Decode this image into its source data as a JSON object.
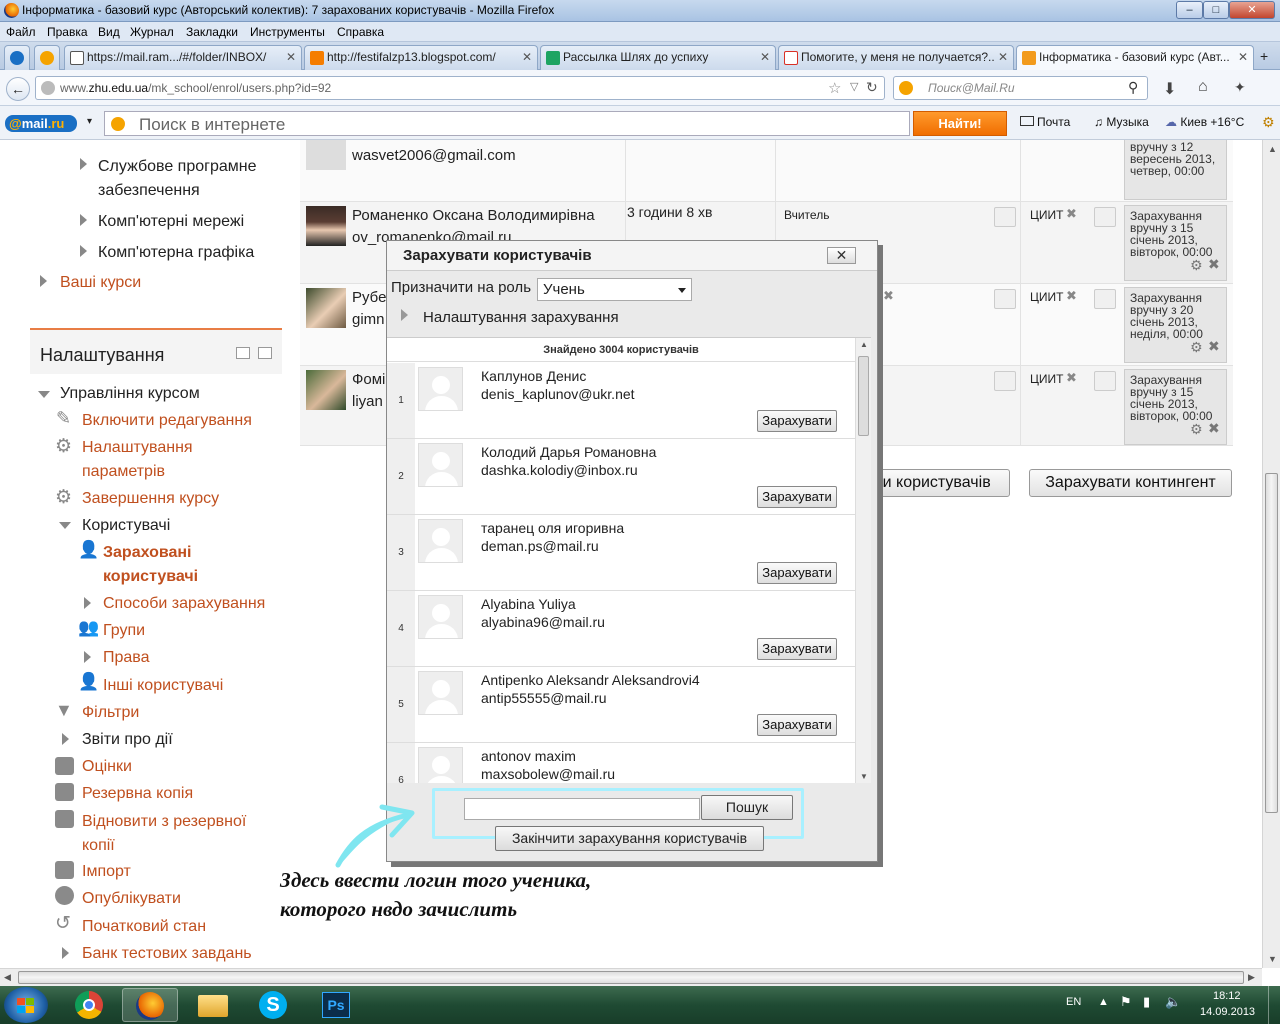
{
  "window": {
    "title": "Інформатика - базовий курс (Авторський колектив): 7 зарахованих користувачів - Mozilla Firefox",
    "buttons": {
      "minimize": "–",
      "maximize": "□",
      "close": "✕"
    }
  },
  "menu": [
    "Файл",
    "Правка",
    "Вид",
    "Журнал",
    "Закладки",
    "Инструменты",
    "Справка"
  ],
  "tabs": [
    {
      "label": "https://mail.ram.../#/folder/INBOX/",
      "icon_color": "#555555"
    },
    {
      "label": "http://festifalzp13.blogspot.com/",
      "icon_color": "#f57d00"
    },
    {
      "label": "Рассылка Шлях до успиху",
      "icon_color": "#1da462"
    },
    {
      "label": "Помогите, у меня не получается?...",
      "icon_color": "#d93025"
    },
    {
      "label": "Інформатика - базовий курс (Авт...",
      "icon_color": "#f29b1d"
    }
  ],
  "nav": {
    "url_prefix": "www.",
    "url_domain": "zhu.edu.ua",
    "url_path": "/mk_school/enrol/users.php?id=92",
    "search_placeholder": "Поиск@Mail.Ru"
  },
  "mailbar": {
    "logo_at": "@",
    "logo_text": "mail",
    "logo_tld": ".ru",
    "search_placeholder": "Поиск в интернете",
    "find_button": "Найти!",
    "mail": "Почта",
    "music": "Музыка",
    "weather": "Киев +16°C"
  },
  "sidebar": {
    "top_items": [
      {
        "label": "Службове програмне"
      },
      {
        "label": "забезпечення"
      },
      {
        "label": "Комп'ютерні мережі"
      },
      {
        "label": "Комп'ютерна графіка"
      }
    ],
    "your_courses": "Ваші курси",
    "settings_title": "Налаштування",
    "course_admin": "Управління курсом",
    "items": [
      {
        "label": "Включити редагування",
        "icon": "pencil-icon"
      },
      {
        "label": "Налаштування параметрів",
        "icon": "gear-icon"
      },
      {
        "label": "Завершення курсу",
        "icon": "gear-icon"
      },
      {
        "label": "Користувачі"
      },
      {
        "label": "Зараховані користувачі",
        "icon": "user-add-icon"
      },
      {
        "label": "Способи зарахування"
      },
      {
        "label": "Групи",
        "icon": "users-icon"
      },
      {
        "label": "Права"
      },
      {
        "label": "Інші користувачі",
        "icon": "user-add-icon"
      },
      {
        "label": "Фільтри",
        "icon": "filter-icon"
      },
      {
        "label": "Звіти про дії"
      },
      {
        "label": "Оцінки",
        "icon": "grades-icon"
      },
      {
        "label": "Резервна копія",
        "icon": "backup-icon"
      },
      {
        "label": "Відновити з резервної копії",
        "icon": "restore-icon"
      },
      {
        "label": "Імпорт",
        "icon": "import-icon"
      },
      {
        "label": "Опублікувати",
        "icon": "publish-icon"
      },
      {
        "label": "Початковий стан",
        "icon": "reset-icon"
      },
      {
        "label": "Банк тестових завдань"
      }
    ]
  },
  "table": {
    "rows": [
      {
        "name": "",
        "email": "wasvet2006@gmail.com",
        "last_access": "",
        "role": "",
        "group": "",
        "status_lines": [
          "вручну з 12",
          "вересень 2013,",
          "четвер, 00:00"
        ]
      },
      {
        "name": "Романенко Оксана Володимирівна",
        "email": "ov_romanenko@mail.ru",
        "last_access": "3 години 8 хв",
        "role": "Вчитель",
        "group": "ЦИИТ",
        "status_lines": [
          "Зарахування",
          "вручну з 15",
          "січень 2013,",
          "вівторок, 00:00"
        ]
      },
      {
        "name": "Рубе",
        "email": "gimn",
        "last_access": "",
        "role": "",
        "group": "ЦИИТ",
        "status_lines": [
          "Зарахування",
          "вручну з 20",
          "січень 2013,",
          "неділя, 00:00"
        ]
      },
      {
        "name": "Фомі",
        "email": "liyan",
        "last_access": "",
        "role": "",
        "group": "ЦИИТ",
        "status_lines": [
          "Зарахування",
          "вручну з 15",
          "січень 2013,",
          "вівторок, 00:00"
        ]
      }
    ],
    "enrol_users_button": "ти користувачів",
    "enrol_cohort_button": "Зарахувати контингент"
  },
  "modal": {
    "title": "Зарахувати користувачів",
    "close": "✕",
    "assign_role_label": "Призначити на роль",
    "role_value": "Учень",
    "enrol_options": "Налаштування зарахування",
    "found_text": "Знайдено 3004 користувачів",
    "enrol_button": "Зарахувати",
    "users": [
      {
        "num": "1",
        "name": "Каплунов Денис",
        "email": "denis_kaplunov@ukr.net"
      },
      {
        "num": "2",
        "name": "Колодий Дарья Романовна",
        "email": "dashka.kolodiy@inbox.ru"
      },
      {
        "num": "3",
        "name": "таранец оля игоривна",
        "email": "deman.ps@mail.ru"
      },
      {
        "num": "4",
        "name": "Alyabina Yuliya",
        "email": "alyabina96@mail.ru"
      },
      {
        "num": "5",
        "name": "Antipenko Aleksandr Aleksandrovi4",
        "email": "antip55555@mail.ru"
      },
      {
        "num": "6",
        "name": "antonov maxim",
        "email": "maxsobolew@mail.ru"
      }
    ],
    "search_button": "Пошук",
    "finish_button": "Закінчити зарахування користувачів"
  },
  "annotation": {
    "line1": "Здесь ввести логин того ученика,",
    "line2": "которого нвдо зачислить",
    "color": "#7fe6f0"
  },
  "taskbar": {
    "lang": "EN",
    "time": "18:12",
    "date": "14.09.2013"
  }
}
